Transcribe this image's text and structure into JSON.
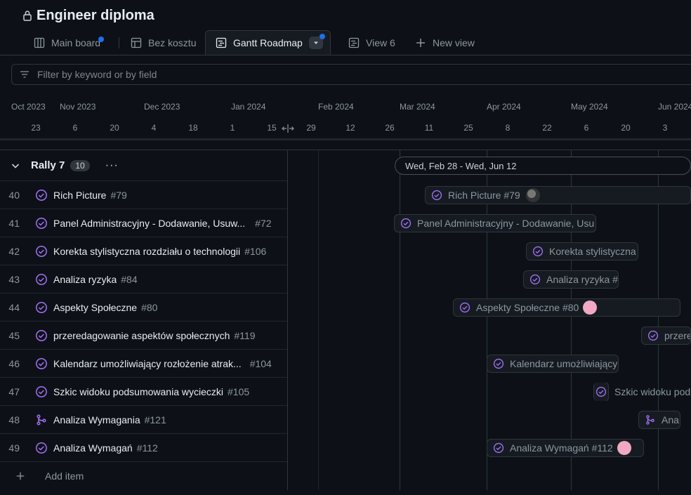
{
  "project": {
    "title": "Engineer diploma"
  },
  "tabs": [
    {
      "label": "Main board"
    },
    {
      "label": "Bez kosztu"
    },
    {
      "label": "Gantt Roadmap"
    },
    {
      "label": "View 6"
    },
    {
      "label": "New view"
    }
  ],
  "filter": {
    "placeholder": "Filter by keyword or by field"
  },
  "timeline": {
    "months": [
      "Oct 2023",
      "Nov 2023",
      "Dec 2023",
      "Jan 2024",
      "Feb 2024",
      "Mar 2024",
      "Apr 2024",
      "May 2024",
      "Jun 2024"
    ],
    "days": [
      "23",
      "6",
      "20",
      "4",
      "18",
      "1",
      "15",
      "29",
      "12",
      "26",
      "11",
      "25",
      "8",
      "22",
      "6",
      "20",
      "3"
    ]
  },
  "group": {
    "title": "Rally 7",
    "count": "10",
    "range": "Wed, Feb 28 - Wed, Jun 12"
  },
  "items": [
    {
      "num": "40",
      "title": "Rich Picture",
      "issue": "#79",
      "bar_label": "Rich Picture #79"
    },
    {
      "num": "41",
      "title": "Panel Administracyjny - Dodawanie, Usuw...",
      "issue": "#72",
      "bar_label": "Panel Administracyjny - Dodawanie, Usu"
    },
    {
      "num": "42",
      "title": "Korekta stylistyczna rozdziału o technologii",
      "issue": "#106",
      "bar_label": "Korekta stylistyczna"
    },
    {
      "num": "43",
      "title": "Analiza ryzyka",
      "issue": "#84",
      "bar_label": "Analiza ryzyka #"
    },
    {
      "num": "44",
      "title": "Aspekty Społeczne",
      "issue": "#80",
      "bar_label": "Aspekty Społeczne #80"
    },
    {
      "num": "45",
      "title": "przeredagowanie aspektów społecznych",
      "issue": "#119",
      "bar_label": "przere"
    },
    {
      "num": "46",
      "title": "Kalendarz umożliwiający rozłożenie atrak...",
      "issue": "#104",
      "bar_label": "Kalendarz umożliwiający"
    },
    {
      "num": "47",
      "title": "Szkic widoku podsumowania wycieczki",
      "issue": "#105",
      "bar_label": "Szkic widoku pod"
    },
    {
      "num": "48",
      "title": "Analiza Wymagania",
      "issue": "#121",
      "bar_label": "Ana"
    },
    {
      "num": "49",
      "title": "Analiza Wymagań",
      "issue": "#112",
      "bar_label": "Analiza Wymagań #112"
    }
  ],
  "add_item": {
    "label": "Add item"
  },
  "colors": {
    "closed": "#a371f7",
    "accent": "#1f6feb",
    "background": "#0d1117"
  }
}
